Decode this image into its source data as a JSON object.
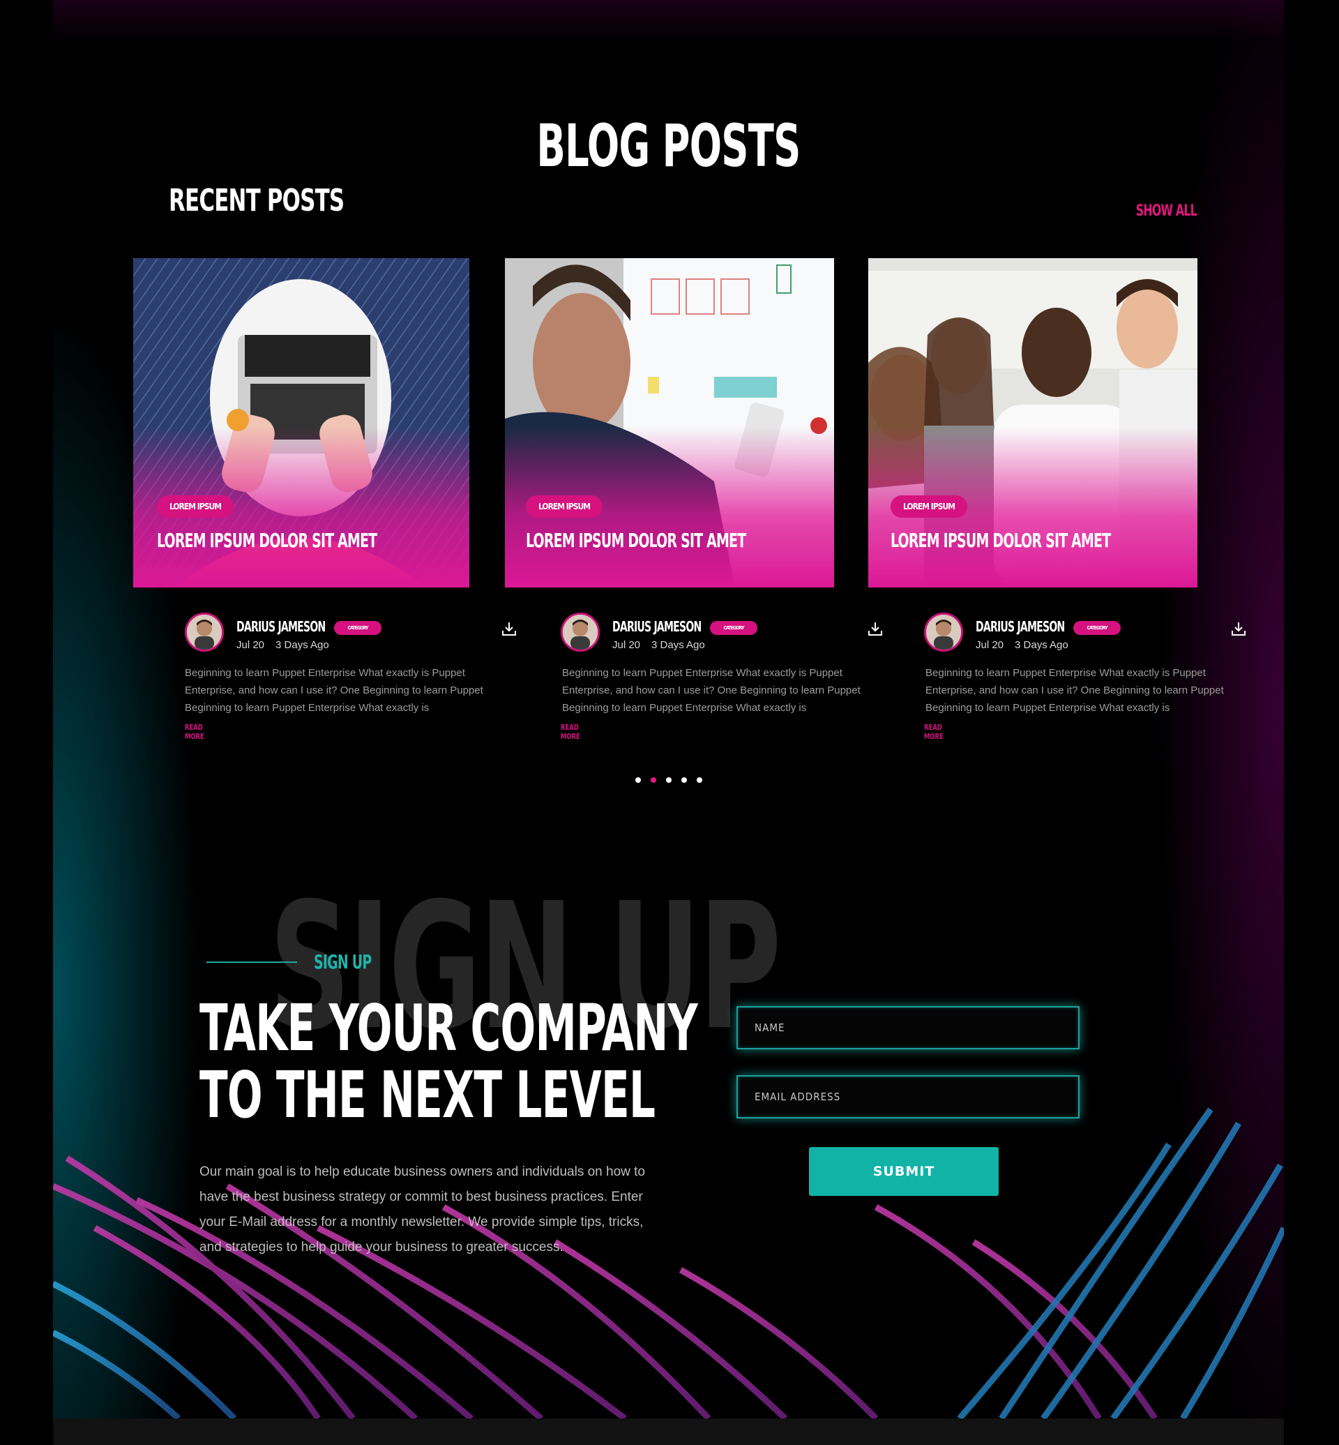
{
  "blog": {
    "title": "BLOG POSTS",
    "subtitle": "RECENT POSTS",
    "show_all": "SHOW ALL"
  },
  "posts": [
    {
      "tag": "LOREM IPSUM",
      "title": "LOREM IPSUM DOLOR SIT AMET",
      "author": "DARIUS JAMESON",
      "category": "CATEGORY",
      "date": "Jul 20",
      "ago": "3 Days Ago",
      "excerpt": "Beginning to learn Puppet Enterprise What exactly is Puppet Enterprise, and how can I use it? One Beginning to learn Puppet Beginning to learn Puppet Enterprise What exactly is",
      "read_more": "READ MORE",
      "image": "laptop-photo"
    },
    {
      "tag": "LOREM IPSUM",
      "title": "LOREM IPSUM DOLOR SIT AMET",
      "author": "DARIUS JAMESON",
      "category": "CATEGORY",
      "date": "Jul 20",
      "ago": "3 Days Ago",
      "excerpt": "Beginning to learn Puppet Enterprise What exactly is Puppet Enterprise, and how can I use it? One Beginning to learn Puppet Beginning to learn Puppet Enterprise What exactly is",
      "read_more": "READ MORE",
      "image": "whiteboard-photo"
    },
    {
      "tag": "LOREM IPSUM",
      "title": "LOREM IPSUM DOLOR SIT AMET",
      "author": "DARIUS JAMESON",
      "category": "CATEGORY",
      "date": "Jul 20",
      "ago": "3 Days Ago",
      "excerpt": "Beginning to learn Puppet Enterprise What exactly is Puppet Enterprise, and how can I use it? One Beginning to learn Puppet Beginning to learn Puppet Enterprise What exactly is",
      "read_more": "READ MORE",
      "image": "team-photo"
    }
  ],
  "carousel": {
    "count": 5,
    "active_index": 1
  },
  "signup": {
    "background_word": "SIGN UP",
    "label": "SIGN UP",
    "headline_line1": "TAKE YOUR COMPANY",
    "headline_line2": "TO THE NEXT LEVEL",
    "description": "Our main goal is to help educate business owners and individuals on how to have the best business strategy or commit to best business practices. Enter your E-Mail address for a monthly newsletter. We provide simple tips, tricks, and strategies to help guide your business to greater success.",
    "name_placeholder": "NAME",
    "email_placeholder": "EMAIL ADDRESS",
    "submit_label": "SUBMIT"
  },
  "colors": {
    "accent_pink": "#e0177f",
    "accent_teal": "#12b3a7",
    "background": "#000000"
  },
  "icons": {
    "download": "download-icon",
    "avatar": "author-avatar"
  }
}
